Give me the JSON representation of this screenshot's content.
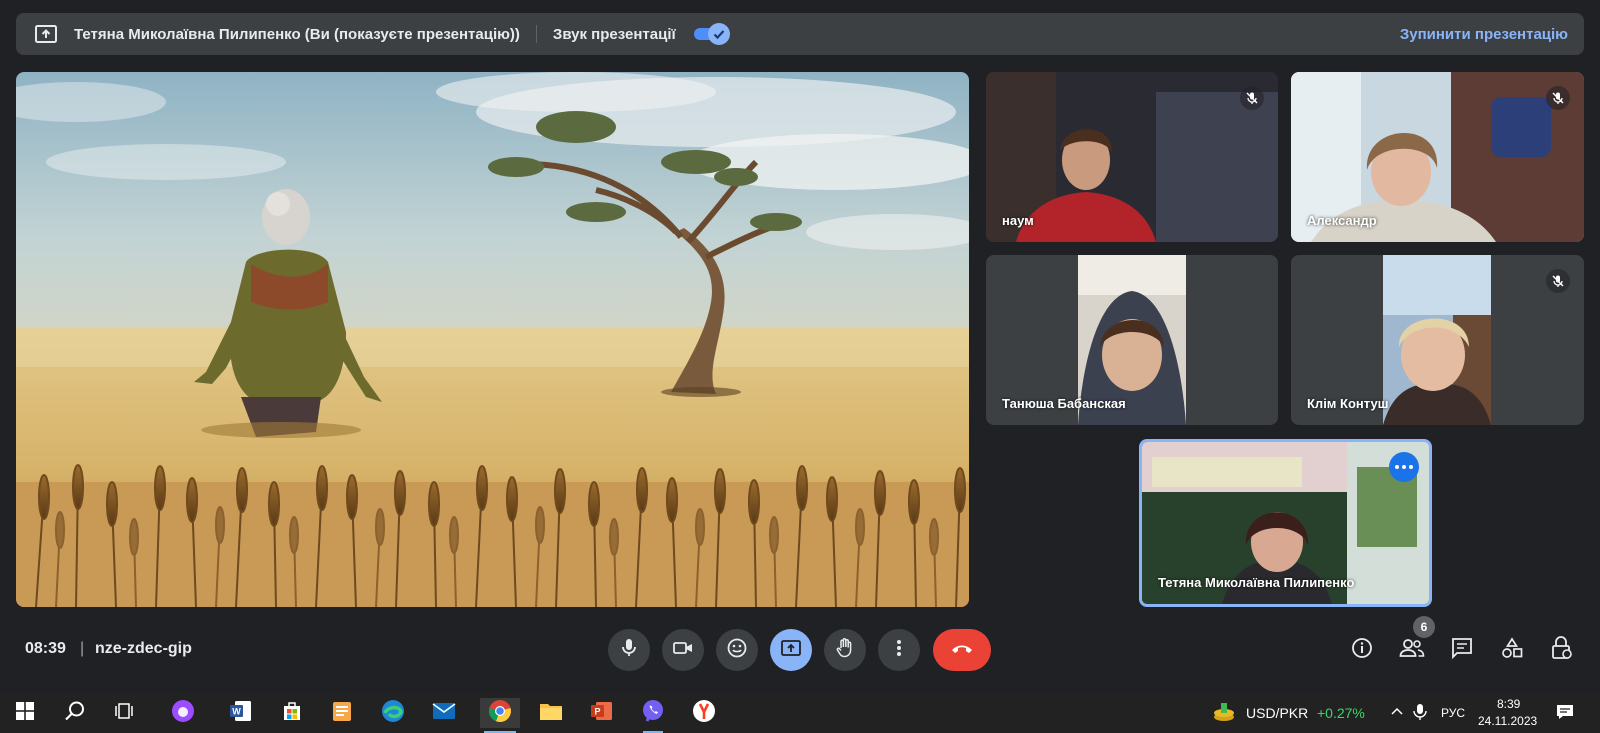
{
  "top_bar": {
    "presenting_text": "Тетяна Миколаївна Пилипенко (Ви (показуєте презентацію))",
    "audio_label": "Звук презентації",
    "audio_enabled": true,
    "stop_label": "Зупинити презентацію"
  },
  "participants": [
    {
      "name": "наум",
      "muted": true
    },
    {
      "name": "Александр",
      "muted": true
    },
    {
      "name": "Танюша Бабанская",
      "muted": false
    },
    {
      "name": "Клім Контуш",
      "muted": true
    },
    {
      "name": "Тетяна Миколаївна Пилипенко",
      "muted": false,
      "self": true
    }
  ],
  "meeting": {
    "time": "08:39",
    "separator": "|",
    "code": "nze-zdec-gip",
    "participant_count": "6"
  },
  "controls": [
    "mic-icon",
    "camera-icon",
    "emoji-icon",
    "present-icon",
    "raise-hand-icon",
    "more-vert-icon",
    "end-call-icon"
  ],
  "right_controls": [
    "info-icon",
    "people-icon",
    "chat-icon",
    "activities-icon",
    "host-controls-icon"
  ],
  "taskbar": {
    "currency": "USD/PKR",
    "change": "+0.27%",
    "lang": "РУС",
    "time": "8:39",
    "date": "24.11.2023"
  },
  "colors": {
    "background": "#202124",
    "accent": "#8ab4f8",
    "end_call": "#ea4335",
    "positive": "#3fd36a"
  }
}
